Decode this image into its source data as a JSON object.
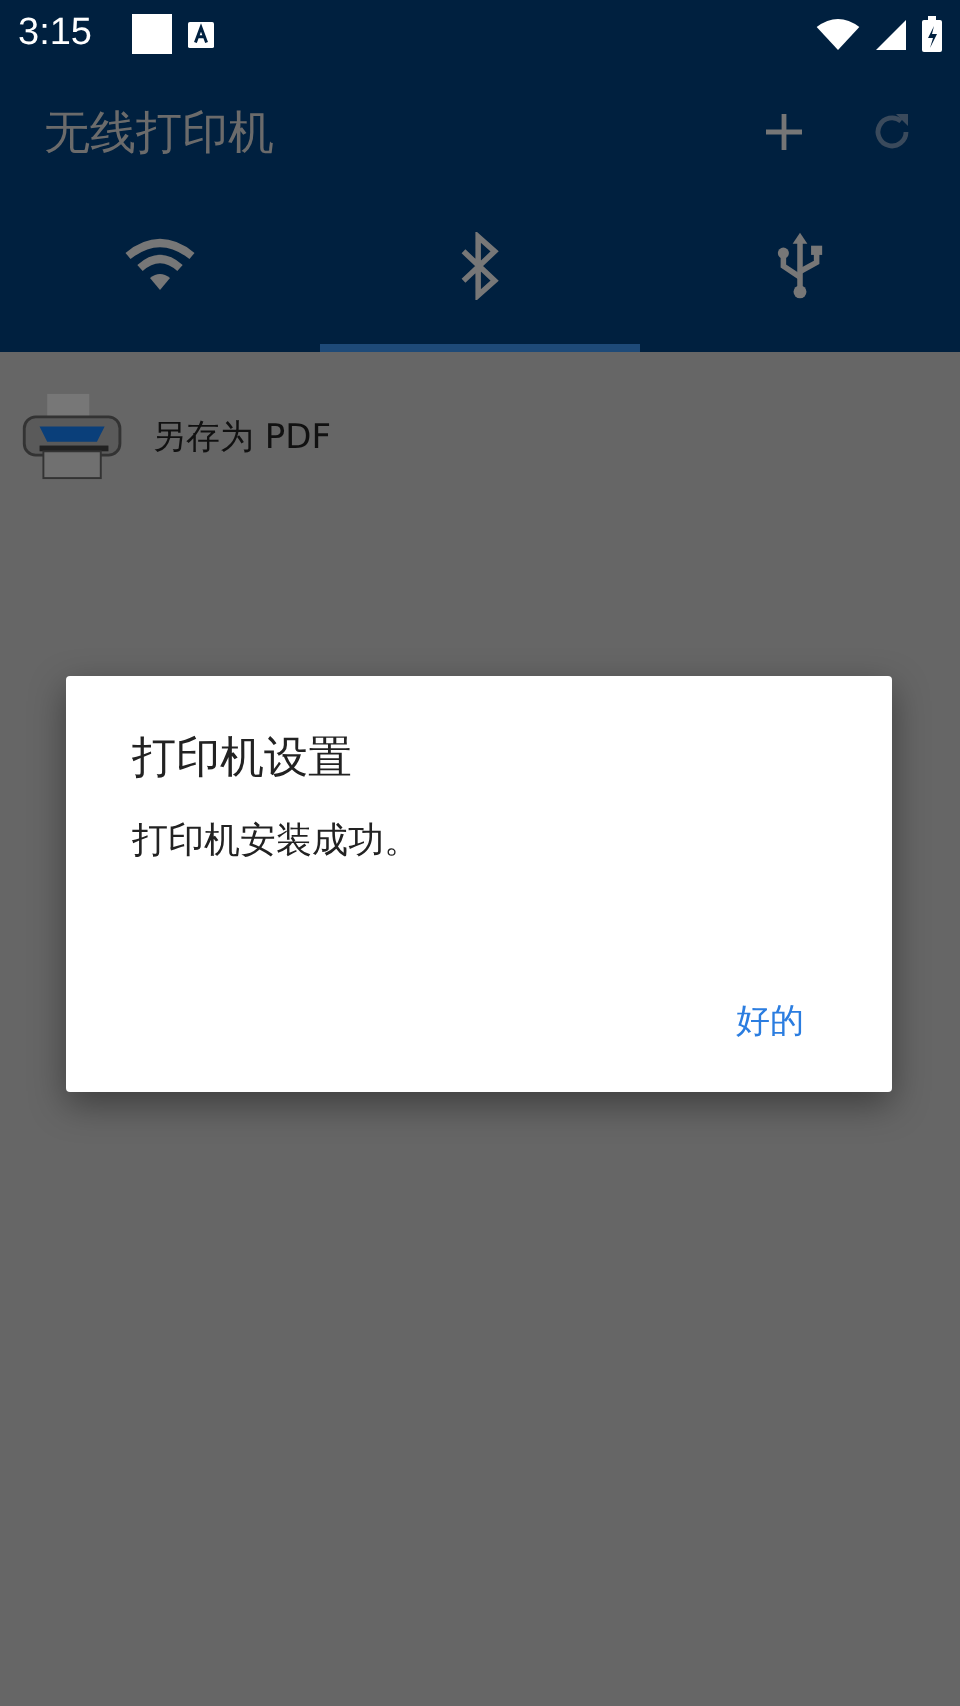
{
  "status_bar": {
    "time": "3:15"
  },
  "app_bar": {
    "title": "无线打印机"
  },
  "tabs": [
    {
      "kind": "wifi",
      "selected": false
    },
    {
      "kind": "bluetooth",
      "selected": true
    },
    {
      "kind": "usb",
      "selected": false
    }
  ],
  "printers": [
    {
      "name": "另存为 PDF"
    }
  ],
  "dialog": {
    "title": "打印机设置",
    "message": "打印机安装成功。",
    "button": "好的"
  }
}
